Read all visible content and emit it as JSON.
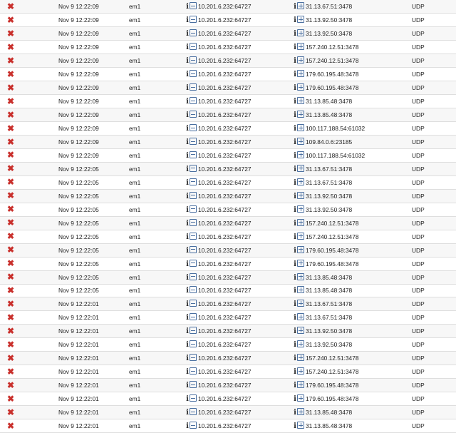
{
  "colors": {
    "block": "#c9302c",
    "row_alt": "#f7f7f7",
    "border": "#dedede",
    "icon_blue": "#4a6fa0"
  },
  "icons": {
    "action": "block-x-icon",
    "info": "info-icon",
    "source_action": "minus-box-icon",
    "destination_action": "plus-box-icon"
  },
  "info_glyph": "i",
  "block_glyph": "✖",
  "rows": [
    {
      "time": "Nov 9 12:22:09",
      "iface": "em1",
      "source": "10.201.6.232:64727",
      "destination": "31.13.67.51:3478",
      "proto": "UDP"
    },
    {
      "time": "Nov 9 12:22:09",
      "iface": "em1",
      "source": "10.201.6.232:64727",
      "destination": "31.13.92.50:3478",
      "proto": "UDP"
    },
    {
      "time": "Nov 9 12:22:09",
      "iface": "em1",
      "source": "10.201.6.232:64727",
      "destination": "31.13.92.50:3478",
      "proto": "UDP"
    },
    {
      "time": "Nov 9 12:22:09",
      "iface": "em1",
      "source": "10.201.6.232:64727",
      "destination": "157.240.12.51:3478",
      "proto": "UDP"
    },
    {
      "time": "Nov 9 12:22:09",
      "iface": "em1",
      "source": "10.201.6.232:64727",
      "destination": "157.240.12.51:3478",
      "proto": "UDP"
    },
    {
      "time": "Nov 9 12:22:09",
      "iface": "em1",
      "source": "10.201.6.232:64727",
      "destination": "179.60.195.48:3478",
      "proto": "UDP"
    },
    {
      "time": "Nov 9 12:22:09",
      "iface": "em1",
      "source": "10.201.6.232:64727",
      "destination": "179.60.195.48:3478",
      "proto": "UDP"
    },
    {
      "time": "Nov 9 12:22:09",
      "iface": "em1",
      "source": "10.201.6.232:64727",
      "destination": "31.13.85.48:3478",
      "proto": "UDP"
    },
    {
      "time": "Nov 9 12:22:09",
      "iface": "em1",
      "source": "10.201.6.232:64727",
      "destination": "31.13.85.48:3478",
      "proto": "UDP"
    },
    {
      "time": "Nov 9 12:22:09",
      "iface": "em1",
      "source": "10.201.6.232:64727",
      "destination": "100.117.188.54:61032",
      "proto": "UDP"
    },
    {
      "time": "Nov 9 12:22:09",
      "iface": "em1",
      "source": "10.201.6.232:64727",
      "destination": "109.84.0.6:23185",
      "proto": "UDP"
    },
    {
      "time": "Nov 9 12:22:09",
      "iface": "em1",
      "source": "10.201.6.232:64727",
      "destination": "100.117.188.54:61032",
      "proto": "UDP"
    },
    {
      "time": "Nov 9 12:22:05",
      "iface": "em1",
      "source": "10.201.6.232:64727",
      "destination": "31.13.67.51:3478",
      "proto": "UDP"
    },
    {
      "time": "Nov 9 12:22:05",
      "iface": "em1",
      "source": "10.201.6.232:64727",
      "destination": "31.13.67.51:3478",
      "proto": "UDP"
    },
    {
      "time": "Nov 9 12:22:05",
      "iface": "em1",
      "source": "10.201.6.232:64727",
      "destination": "31.13.92.50:3478",
      "proto": "UDP"
    },
    {
      "time": "Nov 9 12:22:05",
      "iface": "em1",
      "source": "10.201.6.232:64727",
      "destination": "31.13.92.50:3478",
      "proto": "UDP"
    },
    {
      "time": "Nov 9 12:22:05",
      "iface": "em1",
      "source": "10.201.6.232:64727",
      "destination": "157.240.12.51:3478",
      "proto": "UDP"
    },
    {
      "time": "Nov 9 12:22:05",
      "iface": "em1",
      "source": "10.201.6.232:64727",
      "destination": "157.240.12.51:3478",
      "proto": "UDP"
    },
    {
      "time": "Nov 9 12:22:05",
      "iface": "em1",
      "source": "10.201.6.232:64727",
      "destination": "179.60.195.48:3478",
      "proto": "UDP"
    },
    {
      "time": "Nov 9 12:22:05",
      "iface": "em1",
      "source": "10.201.6.232:64727",
      "destination": "179.60.195.48:3478",
      "proto": "UDP"
    },
    {
      "time": "Nov 9 12:22:05",
      "iface": "em1",
      "source": "10.201.6.232:64727",
      "destination": "31.13.85.48:3478",
      "proto": "UDP"
    },
    {
      "time": "Nov 9 12:22:05",
      "iface": "em1",
      "source": "10.201.6.232:64727",
      "destination": "31.13.85.48:3478",
      "proto": "UDP"
    },
    {
      "time": "Nov 9 12:22:01",
      "iface": "em1",
      "source": "10.201.6.232:64727",
      "destination": "31.13.67.51:3478",
      "proto": "UDP"
    },
    {
      "time": "Nov 9 12:22:01",
      "iface": "em1",
      "source": "10.201.6.232:64727",
      "destination": "31.13.67.51:3478",
      "proto": "UDP"
    },
    {
      "time": "Nov 9 12:22:01",
      "iface": "em1",
      "source": "10.201.6.232:64727",
      "destination": "31.13.92.50:3478",
      "proto": "UDP"
    },
    {
      "time": "Nov 9 12:22:01",
      "iface": "em1",
      "source": "10.201.6.232:64727",
      "destination": "31.13.92.50:3478",
      "proto": "UDP"
    },
    {
      "time": "Nov 9 12:22:01",
      "iface": "em1",
      "source": "10.201.6.232:64727",
      "destination": "157.240.12.51:3478",
      "proto": "UDP"
    },
    {
      "time": "Nov 9 12:22:01",
      "iface": "em1",
      "source": "10.201.6.232:64727",
      "destination": "157.240.12.51:3478",
      "proto": "UDP"
    },
    {
      "time": "Nov 9 12:22:01",
      "iface": "em1",
      "source": "10.201.6.232:64727",
      "destination": "179.60.195.48:3478",
      "proto": "UDP"
    },
    {
      "time": "Nov 9 12:22:01",
      "iface": "em1",
      "source": "10.201.6.232:64727",
      "destination": "179.60.195.48:3478",
      "proto": "UDP"
    },
    {
      "time": "Nov 9 12:22:01",
      "iface": "em1",
      "source": "10.201.6.232:64727",
      "destination": "31.13.85.48:3478",
      "proto": "UDP"
    },
    {
      "time": "Nov 9 12:22:01",
      "iface": "em1",
      "source": "10.201.6.232:64727",
      "destination": "31.13.85.48:3478",
      "proto": "UDP"
    }
  ]
}
